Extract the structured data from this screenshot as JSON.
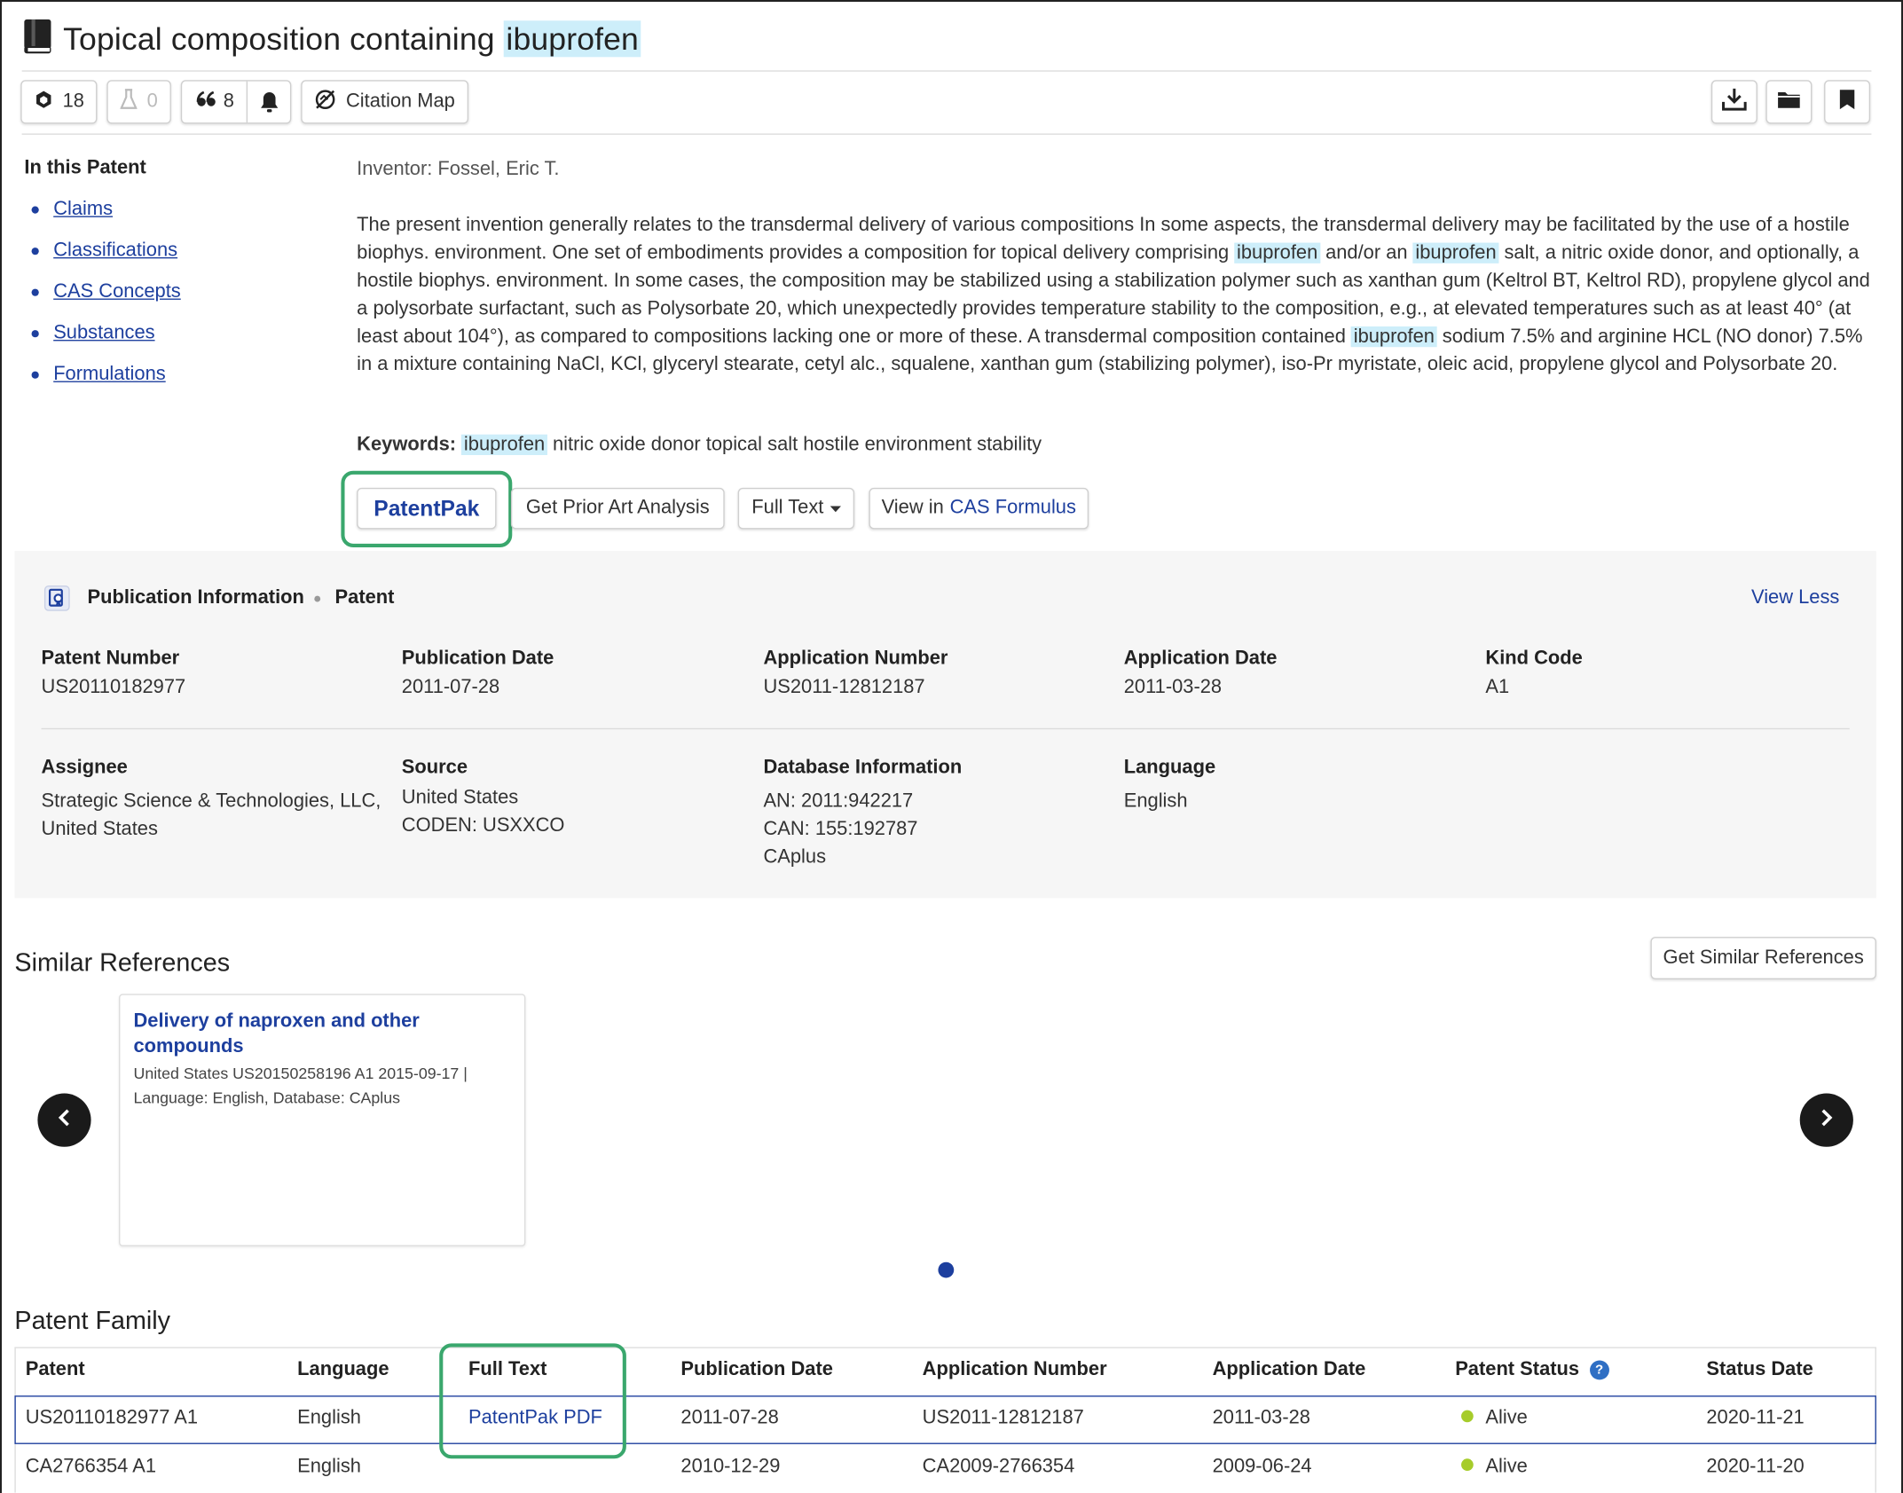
{
  "header": {
    "title_prefix": "Topical composition containing",
    "title_highlight": "ibuprofen",
    "toolbar": {
      "substances_count": "18",
      "reactions_count": "0",
      "citations_count": "8",
      "citation_map_label": "Citation Map"
    }
  },
  "nav": {
    "title": "In this Patent",
    "items": [
      "Claims",
      "Classifications",
      "CAS Concepts",
      "Substances",
      "Formulations"
    ]
  },
  "abstract": {
    "inventor": "Inventor: Fossel, Eric T.",
    "keywords_label": "Keywords:",
    "keywords_highlight": "ibuprofen",
    "keywords_rest": "nitric oxide donor topical salt hostile environment stability",
    "text_segments": [
      {
        "t": "The present invention generally relates to the transdermal delivery of various compositions In some aspects, the transdermal delivery may be facilitated by the use of a hostile biophys. environment. One set of embodiments provides a composition for topical delivery comprising ",
        "hl": false
      },
      {
        "t": "ibuprofen",
        "hl": true
      },
      {
        "t": " and/or an ",
        "hl": false
      },
      {
        "t": "ibuprofen",
        "hl": true
      },
      {
        "t": " salt, a nitric oxide donor, and optionally, a hostile biophys. environment. In some cases, the composition may be stabilized using a stabilization polymer such as xanthan gum (Keltrol BT, Keltrol RD), propylene glycol and a polysorbate surfactant, such as Polysorbate 20, which unexpectedly provides temperature stability to the composition, e.g., at elevated temperatures such as at least 40° (at least about 104°), as compared to compositions lacking one or more of these. A transdermal composition contained ",
        "hl": false
      },
      {
        "t": "ibuprofen",
        "hl": true
      },
      {
        "t": " sodium 7.5% and arginine HCL (NO donor) 7.5% in a mixture containing NaCl, KCl, glyceryl stearate, cetyl alc., squalene, xanthan gum (stabilizing polymer), iso-Pr myristate, oleic acid, propylene glycol and Polysorbate 20.",
        "hl": false
      }
    ]
  },
  "actions": {
    "patentpak": "PatentPak",
    "prior_art": "Get Prior Art Analysis",
    "full_text": "Full Text",
    "view_in": "View in",
    "cas_formulus": "CAS Formulus"
  },
  "publication": {
    "heading": "Publication Information",
    "type": "Patent",
    "view_less": "View Less",
    "fields": {
      "patent_number_label": "Patent Number",
      "patent_number": "US20110182977",
      "pub_date_label": "Publication Date",
      "pub_date": "2011-07-28",
      "app_number_label": "Application Number",
      "app_number": "US2011-12812187",
      "app_date_label": "Application Date",
      "app_date": "2011-03-28",
      "kind_code_label": "Kind Code",
      "kind_code": "A1",
      "assignee_label": "Assignee",
      "assignee_line1": "Strategic Science & Technologies, LLC,",
      "assignee_line2": "United States",
      "source_label": "Source",
      "source_line1": "United States",
      "source_line2": "CODEN: USXXCO",
      "db_label": "Database Information",
      "db_line1": "AN: 2011:942217",
      "db_line2": "CAN: 155:192787",
      "db_line3": "CAplus",
      "language_label": "Language",
      "language": "English"
    }
  },
  "similar": {
    "heading": "Similar References",
    "get_button": "Get Similar References",
    "card_title_line1": "Delivery of naproxen and other",
    "card_title_line2": "compounds",
    "card_meta_line1": "United States US20150258196 A1 2015-09-17 |",
    "card_meta_line2": "Language: English, Database: CAplus"
  },
  "family": {
    "heading": "Patent Family",
    "columns": [
      "Patent",
      "Language",
      "Full Text",
      "Publication Date",
      "Application Number",
      "Application Date",
      "Patent Status",
      "Status Date"
    ],
    "rows": [
      {
        "patent": "US20110182977 A1",
        "language": "English",
        "full_text": "PatentPak PDF",
        "pub_date": "2011-07-28",
        "app_number": "US2011-12812187",
        "app_date": "2011-03-28",
        "status": "Alive",
        "status_date": "2020-11-21"
      },
      {
        "patent": "CA2766354 A1",
        "language": "English",
        "full_text": "",
        "pub_date": "2010-12-29",
        "app_number": "CA2009-2766354",
        "app_date": "2009-06-24",
        "status": "Alive",
        "status_date": "2020-11-20"
      }
    ]
  },
  "colors": {
    "link": "#1d3f9e",
    "highlight": "#cdeefa",
    "callout_green": "#3aa76d",
    "status_alive": "#a6cc2a"
  }
}
